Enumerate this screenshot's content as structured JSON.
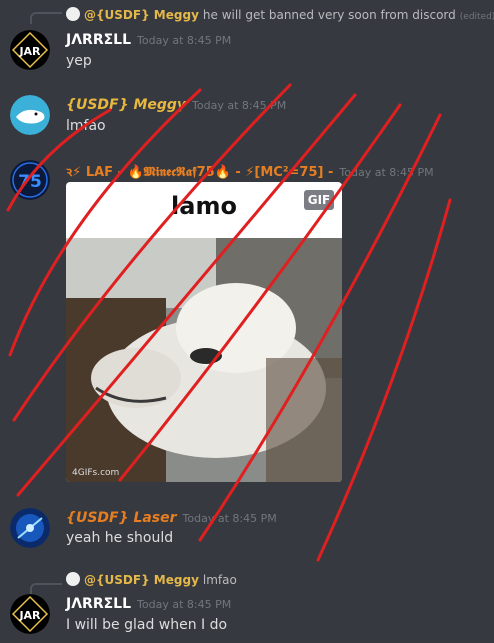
{
  "messages": [
    {
      "reply": {
        "name": "@{USDF} Meggy",
        "text": "he will get banned very soon from discord",
        "edited": "(edited)"
      },
      "author": "JΛRRΣLL",
      "time": "Today at 8:45 PM",
      "text": "yep"
    },
    {
      "author": "{USDF} Meggy",
      "time": "Today at 8:45 PM",
      "text": "lmfao"
    },
    {
      "author": "ꝛ⚡ LAF - 🔥𝕸𝖎𝖓𝖊𝖈𝕽𝖆𝖋75🔥 - ⚡[MC²=75] -",
      "time": "Today at 8:45 PM",
      "embed": {
        "title": "lamo",
        "badge": "GIF",
        "watermark": "4GIFs.com"
      }
    },
    {
      "author": "{USDF} Laser",
      "time": "Today at 8:45 PM",
      "text": "yeah he should"
    },
    {
      "reply": {
        "name": "@{USDF} Meggy",
        "text": "lmfao"
      },
      "author": "JΛRRΣLL",
      "time": "Today at 8:45 PM",
      "text": "I will be glad when I do"
    }
  ],
  "colors": {
    "background": "#36393f",
    "gold_name": "#e8b73f",
    "orange_name": "#e67e22",
    "scribble": "#e02020"
  },
  "icons": [
    "reply-arrow-icon",
    "jar-avatar-icon",
    "whale-avatar-icon",
    "75-avatar-icon",
    "laser-avatar-icon"
  ]
}
